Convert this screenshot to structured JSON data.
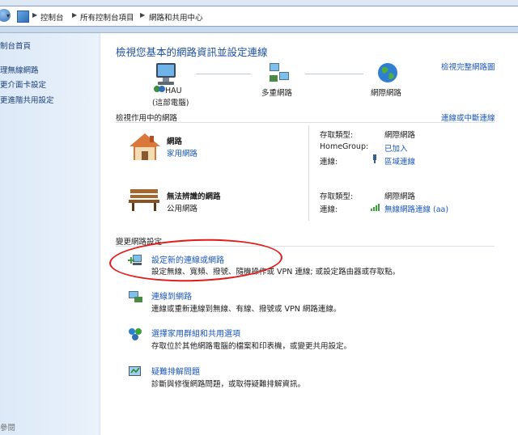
{
  "breadcrumb": [
    "控制台",
    "所有控制台項目",
    "網路和共用中心"
  ],
  "sidebar": {
    "items": [
      "制台首頁",
      "理無線網路",
      "更介面卡設定",
      "更進階共用設定"
    ],
    "footer": "參閱"
  },
  "header": {
    "title": "檢視您基本的網路資訊並設定連線",
    "full_map": "檢視完整網路圖"
  },
  "map": {
    "computer_name": "HAU",
    "computer_sub": "(這部電腦)",
    "multi_net": "多重網路",
    "internet": "網際網路"
  },
  "active": {
    "heading": "檢視作用中的網路",
    "disconnect": "連線或中斷連線",
    "networks": [
      {
        "name": "網路",
        "type": "家用網路",
        "access_label": "存取類型:",
        "access_value": "網際網路",
        "homegroup_label": "HomeGroup:",
        "homegroup_value": "已加入",
        "conn_label": "連線:",
        "conn_value": "區域連線"
      },
      {
        "name": "無法辨識的網路",
        "type": "公用網路",
        "access_label": "存取類型:",
        "access_value": "網際網路",
        "conn_label": "連線:",
        "conn_value": "無線網路連線 (aa)"
      }
    ]
  },
  "change": {
    "heading": "變更網路設定",
    "tasks": [
      {
        "title": "設定新的連線或網路",
        "desc": "設定無線、寬頻、撥號、隨機操作或 VPN 連線; 或設定路由器或存取點。"
      },
      {
        "title": "連線到網路",
        "desc": "連線或重新連線到無線、有線、撥號或 VPN 網路連線。"
      },
      {
        "title": "選擇家用群組和共用選項",
        "desc": "存取位於其他網路電腦的檔案和印表機，或變更共用設定。"
      },
      {
        "title": "疑難排解問題",
        "desc": "診斷與修復網路問題，或取得疑難排解資訊。"
      }
    ]
  },
  "colors": {
    "link": "#1b57b5",
    "title": "#1d4f9c",
    "annotation": "#e21a1a"
  }
}
